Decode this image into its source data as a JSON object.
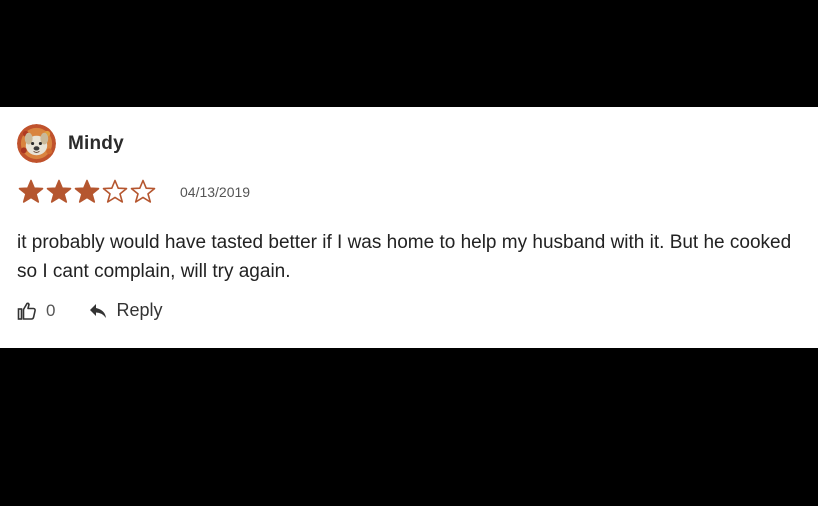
{
  "review": {
    "author": "Mindy",
    "avatar_icon": "dog-avatar-icon",
    "rating": 3,
    "max_rating": 5,
    "date": "04/13/2019",
    "text": "it probably would have tasted better if I was home to help my husband with it. But he cooked so I cant complain, will try again.",
    "helpful_count": "0",
    "reply_label": "Reply"
  },
  "colors": {
    "star": "#b5562f",
    "background_outer": "#000000",
    "card_background": "#ffffff"
  }
}
